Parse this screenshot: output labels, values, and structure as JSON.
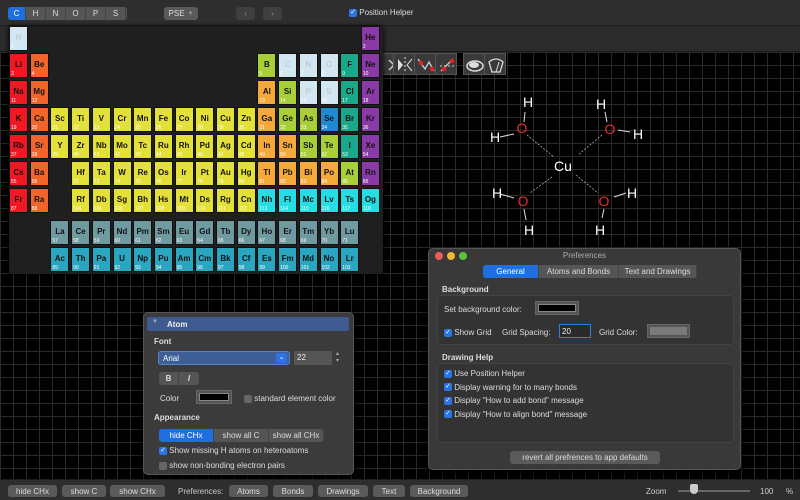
{
  "topbar": {
    "element_buttons": [
      {
        "label": "C",
        "selected": true
      },
      {
        "label": "H",
        "selected": false
      },
      {
        "label": "N",
        "selected": false
      },
      {
        "label": "O",
        "selected": false
      },
      {
        "label": "P",
        "selected": false
      },
      {
        "label": "S",
        "selected": false
      }
    ],
    "pse_label": "PSE",
    "back_icon": "chevron-left",
    "forward_icon": "chevron-right",
    "position_helper_label": "Position Helper",
    "position_helper_checked": true
  },
  "toolbar": {
    "tools": [
      "rotate-tool",
      "mirror-tool",
      "flip-bond-red-tool",
      "flip-bond-red-alt-tool",
      "eraser-tool",
      "wiper-tool"
    ]
  },
  "periodic_table": {
    "elements": [
      {
        "s": "H",
        "n": 1,
        "r": 1,
        "c": 1,
        "cat": "nonmetal-light"
      },
      {
        "s": "He",
        "n": 2,
        "r": 1,
        "c": 18,
        "cat": "noble"
      },
      {
        "s": "Li",
        "n": 3,
        "r": 2,
        "c": 1,
        "cat": "alkali"
      },
      {
        "s": "Be",
        "n": 4,
        "r": 2,
        "c": 2,
        "cat": "alkaline"
      },
      {
        "s": "B",
        "n": 5,
        "r": 2,
        "c": 13,
        "cat": "metalloid"
      },
      {
        "s": "C",
        "n": 6,
        "r": 2,
        "c": 14,
        "cat": "nonmetal-light"
      },
      {
        "s": "N",
        "n": 7,
        "r": 2,
        "c": 15,
        "cat": "nonmetal-light"
      },
      {
        "s": "O",
        "n": 8,
        "r": 2,
        "c": 16,
        "cat": "nonmetal-light"
      },
      {
        "s": "F",
        "n": 9,
        "r": 2,
        "c": 17,
        "cat": "halogen"
      },
      {
        "s": "Ne",
        "n": 10,
        "r": 2,
        "c": 18,
        "cat": "noble"
      },
      {
        "s": "Na",
        "n": 11,
        "r": 3,
        "c": 1,
        "cat": "alkali"
      },
      {
        "s": "Mg",
        "n": 12,
        "r": 3,
        "c": 2,
        "cat": "alkaline"
      },
      {
        "s": "Al",
        "n": 13,
        "r": 3,
        "c": 13,
        "cat": "post"
      },
      {
        "s": "Si",
        "n": 14,
        "r": 3,
        "c": 14,
        "cat": "metalloid"
      },
      {
        "s": "P",
        "n": 15,
        "r": 3,
        "c": 15,
        "cat": "nonmetal-light"
      },
      {
        "s": "S",
        "n": 16,
        "r": 3,
        "c": 16,
        "cat": "nonmetal-light"
      },
      {
        "s": "Cl",
        "n": 17,
        "r": 3,
        "c": 17,
        "cat": "halogen"
      },
      {
        "s": "Ar",
        "n": 18,
        "r": 3,
        "c": 18,
        "cat": "noble"
      },
      {
        "s": "K",
        "n": 19,
        "r": 4,
        "c": 1,
        "cat": "alkali"
      },
      {
        "s": "Ca",
        "n": 20,
        "r": 4,
        "c": 2,
        "cat": "alkaline"
      },
      {
        "s": "Sc",
        "n": 21,
        "r": 4,
        "c": 3,
        "cat": "transition"
      },
      {
        "s": "Ti",
        "n": 22,
        "r": 4,
        "c": 4,
        "cat": "transition"
      },
      {
        "s": "V",
        "n": 23,
        "r": 4,
        "c": 5,
        "cat": "transition"
      },
      {
        "s": "Cr",
        "n": 24,
        "r": 4,
        "c": 6,
        "cat": "transition"
      },
      {
        "s": "Mn",
        "n": 25,
        "r": 4,
        "c": 7,
        "cat": "transition"
      },
      {
        "s": "Fe",
        "n": 26,
        "r": 4,
        "c": 8,
        "cat": "transition"
      },
      {
        "s": "Co",
        "n": 27,
        "r": 4,
        "c": 9,
        "cat": "transition"
      },
      {
        "s": "Ni",
        "n": 28,
        "r": 4,
        "c": 10,
        "cat": "transition"
      },
      {
        "s": "Cu",
        "n": 29,
        "r": 4,
        "c": 11,
        "cat": "transition"
      },
      {
        "s": "Zn",
        "n": 30,
        "r": 4,
        "c": 12,
        "cat": "transition"
      },
      {
        "s": "Ga",
        "n": 31,
        "r": 4,
        "c": 13,
        "cat": "post"
      },
      {
        "s": "Ge",
        "n": 32,
        "r": 4,
        "c": 14,
        "cat": "metalloid"
      },
      {
        "s": "As",
        "n": 33,
        "r": 4,
        "c": 15,
        "cat": "metalloid"
      },
      {
        "s": "Se",
        "n": 34,
        "r": 4,
        "c": 16,
        "cat": "selenium"
      },
      {
        "s": "Br",
        "n": 35,
        "r": 4,
        "c": 17,
        "cat": "halogen"
      },
      {
        "s": "Kr",
        "n": 36,
        "r": 4,
        "c": 18,
        "cat": "noble"
      },
      {
        "s": "Rb",
        "n": 37,
        "r": 5,
        "c": 1,
        "cat": "alkali"
      },
      {
        "s": "Sr",
        "n": 38,
        "r": 5,
        "c": 2,
        "cat": "alkaline"
      },
      {
        "s": "Y",
        "n": 39,
        "r": 5,
        "c": 3,
        "cat": "transition"
      },
      {
        "s": "Zr",
        "n": 40,
        "r": 5,
        "c": 4,
        "cat": "transition"
      },
      {
        "s": "Nb",
        "n": 41,
        "r": 5,
        "c": 5,
        "cat": "transition"
      },
      {
        "s": "Mo",
        "n": 42,
        "r": 5,
        "c": 6,
        "cat": "transition"
      },
      {
        "s": "Tc",
        "n": 43,
        "r": 5,
        "c": 7,
        "cat": "transition"
      },
      {
        "s": "Ru",
        "n": 44,
        "r": 5,
        "c": 8,
        "cat": "transition"
      },
      {
        "s": "Rh",
        "n": 45,
        "r": 5,
        "c": 9,
        "cat": "transition"
      },
      {
        "s": "Pd",
        "n": 46,
        "r": 5,
        "c": 10,
        "cat": "transition"
      },
      {
        "s": "Ag",
        "n": 47,
        "r": 5,
        "c": 11,
        "cat": "transition"
      },
      {
        "s": "Cd",
        "n": 48,
        "r": 5,
        "c": 12,
        "cat": "transition"
      },
      {
        "s": "In",
        "n": 49,
        "r": 5,
        "c": 13,
        "cat": "post"
      },
      {
        "s": "Sn",
        "n": 50,
        "r": 5,
        "c": 14,
        "cat": "post"
      },
      {
        "s": "Sb",
        "n": 51,
        "r": 5,
        "c": 15,
        "cat": "metalloid"
      },
      {
        "s": "Te",
        "n": 52,
        "r": 5,
        "c": 16,
        "cat": "metalloid"
      },
      {
        "s": "I",
        "n": 53,
        "r": 5,
        "c": 17,
        "cat": "halogen"
      },
      {
        "s": "Xe",
        "n": 54,
        "r": 5,
        "c": 18,
        "cat": "noble"
      },
      {
        "s": "Cs",
        "n": 55,
        "r": 6,
        "c": 1,
        "cat": "alkali"
      },
      {
        "s": "Ba",
        "n": 56,
        "r": 6,
        "c": 2,
        "cat": "alkaline"
      },
      {
        "s": "Hf",
        "n": 72,
        "r": 6,
        "c": 4,
        "cat": "transition"
      },
      {
        "s": "Ta",
        "n": 73,
        "r": 6,
        "c": 5,
        "cat": "transition"
      },
      {
        "s": "W",
        "n": 74,
        "r": 6,
        "c": 6,
        "cat": "transition"
      },
      {
        "s": "Re",
        "n": 75,
        "r": 6,
        "c": 7,
        "cat": "transition"
      },
      {
        "s": "Os",
        "n": 76,
        "r": 6,
        "c": 8,
        "cat": "transition"
      },
      {
        "s": "Ir",
        "n": 77,
        "r": 6,
        "c": 9,
        "cat": "transition"
      },
      {
        "s": "Pt",
        "n": 78,
        "r": 6,
        "c": 10,
        "cat": "transition"
      },
      {
        "s": "Au",
        "n": 79,
        "r": 6,
        "c": 11,
        "cat": "transition"
      },
      {
        "s": "Hg",
        "n": 80,
        "r": 6,
        "c": 12,
        "cat": "transition"
      },
      {
        "s": "Tl",
        "n": 81,
        "r": 6,
        "c": 13,
        "cat": "post"
      },
      {
        "s": "Pb",
        "n": 82,
        "r": 6,
        "c": 14,
        "cat": "post"
      },
      {
        "s": "Bi",
        "n": 83,
        "r": 6,
        "c": 15,
        "cat": "post"
      },
      {
        "s": "Po",
        "n": 84,
        "r": 6,
        "c": 16,
        "cat": "post"
      },
      {
        "s": "At",
        "n": 85,
        "r": 6,
        "c": 17,
        "cat": "metalloid"
      },
      {
        "s": "Rn",
        "n": 86,
        "r": 6,
        "c": 18,
        "cat": "noble"
      },
      {
        "s": "Fr",
        "n": 87,
        "r": 7,
        "c": 1,
        "cat": "alkali"
      },
      {
        "s": "Ra",
        "n": 88,
        "r": 7,
        "c": 2,
        "cat": "alkaline"
      },
      {
        "s": "Rf",
        "n": 104,
        "r": 7,
        "c": 4,
        "cat": "transition"
      },
      {
        "s": "Db",
        "n": 105,
        "r": 7,
        "c": 5,
        "cat": "transition"
      },
      {
        "s": "Sg",
        "n": 106,
        "r": 7,
        "c": 6,
        "cat": "transition"
      },
      {
        "s": "Bh",
        "n": 107,
        "r": 7,
        "c": 7,
        "cat": "transition"
      },
      {
        "s": "Hs",
        "n": 108,
        "r": 7,
        "c": 8,
        "cat": "transition"
      },
      {
        "s": "Mt",
        "n": 109,
        "r": 7,
        "c": 9,
        "cat": "transition"
      },
      {
        "s": "Ds",
        "n": 110,
        "r": 7,
        "c": 10,
        "cat": "transition"
      },
      {
        "s": "Rg",
        "n": 111,
        "r": 7,
        "c": 11,
        "cat": "transition"
      },
      {
        "s": "Cn",
        "n": 112,
        "r": 7,
        "c": 12,
        "cat": "transition"
      },
      {
        "s": "Nh",
        "n": 113,
        "r": 7,
        "c": 13,
        "cat": "unknown"
      },
      {
        "s": "Fl",
        "n": 114,
        "r": 7,
        "c": 14,
        "cat": "unknown"
      },
      {
        "s": "Mc",
        "n": 115,
        "r": 7,
        "c": 15,
        "cat": "unknown"
      },
      {
        "s": "Lv",
        "n": 116,
        "r": 7,
        "c": 16,
        "cat": "unknown"
      },
      {
        "s": "Ts",
        "n": 117,
        "r": 7,
        "c": 17,
        "cat": "unknown"
      },
      {
        "s": "Og",
        "n": 118,
        "r": 7,
        "c": 18,
        "cat": "unknown"
      },
      {
        "s": "La",
        "n": 57,
        "r": 8,
        "c": 3,
        "cat": "lanthanide"
      },
      {
        "s": "Ce",
        "n": 58,
        "r": 8,
        "c": 4,
        "cat": "lanthanide"
      },
      {
        "s": "Pr",
        "n": 59,
        "r": 8,
        "c": 5,
        "cat": "lanthanide"
      },
      {
        "s": "Nd",
        "n": 60,
        "r": 8,
        "c": 6,
        "cat": "lanthanide"
      },
      {
        "s": "Pm",
        "n": 61,
        "r": 8,
        "c": 7,
        "cat": "lanthanide"
      },
      {
        "s": "Sm",
        "n": 62,
        "r": 8,
        "c": 8,
        "cat": "lanthanide"
      },
      {
        "s": "Eu",
        "n": 63,
        "r": 8,
        "c": 9,
        "cat": "lanthanide"
      },
      {
        "s": "Gd",
        "n": 64,
        "r": 8,
        "c": 10,
        "cat": "lanthanide"
      },
      {
        "s": "Tb",
        "n": 65,
        "r": 8,
        "c": 11,
        "cat": "lanthanide"
      },
      {
        "s": "Dy",
        "n": 66,
        "r": 8,
        "c": 12,
        "cat": "lanthanide"
      },
      {
        "s": "Ho",
        "n": 67,
        "r": 8,
        "c": 13,
        "cat": "lanthanide"
      },
      {
        "s": "Er",
        "n": 68,
        "r": 8,
        "c": 14,
        "cat": "lanthanide"
      },
      {
        "s": "Tm",
        "n": 69,
        "r": 8,
        "c": 15,
        "cat": "lanthanide"
      },
      {
        "s": "Yb",
        "n": 70,
        "r": 8,
        "c": 16,
        "cat": "lanthanide"
      },
      {
        "s": "Lu",
        "n": 71,
        "r": 8,
        "c": 17,
        "cat": "lanthanide"
      },
      {
        "s": "Ac",
        "n": 89,
        "r": 9,
        "c": 3,
        "cat": "actinide"
      },
      {
        "s": "Th",
        "n": 90,
        "r": 9,
        "c": 4,
        "cat": "actinide"
      },
      {
        "s": "Pa",
        "n": 91,
        "r": 9,
        "c": 5,
        "cat": "actinide"
      },
      {
        "s": "U",
        "n": 92,
        "r": 9,
        "c": 6,
        "cat": "actinide"
      },
      {
        "s": "Np",
        "n": 93,
        "r": 9,
        "c": 7,
        "cat": "actinide"
      },
      {
        "s": "Pu",
        "n": 94,
        "r": 9,
        "c": 8,
        "cat": "actinide"
      },
      {
        "s": "Am",
        "n": 95,
        "r": 9,
        "c": 9,
        "cat": "actinide"
      },
      {
        "s": "Cm",
        "n": 96,
        "r": 9,
        "c": 10,
        "cat": "actinide"
      },
      {
        "s": "Bk",
        "n": 97,
        "r": 9,
        "c": 11,
        "cat": "actinide"
      },
      {
        "s": "Cf",
        "n": 98,
        "r": 9,
        "c": 12,
        "cat": "actinide"
      },
      {
        "s": "Es",
        "n": 99,
        "r": 9,
        "c": 13,
        "cat": "actinide"
      },
      {
        "s": "Fm",
        "n": 100,
        "r": 9,
        "c": 14,
        "cat": "actinide"
      },
      {
        "s": "Md",
        "n": 101,
        "r": 9,
        "c": 15,
        "cat": "actinide"
      },
      {
        "s": "No",
        "n": 102,
        "r": 9,
        "c": 16,
        "cat": "actinide"
      },
      {
        "s": "Lr",
        "n": 103,
        "r": 9,
        "c": 17,
        "cat": "actinide"
      }
    ],
    "category_colors": {
      "alkali": "#f01822",
      "alkaline": "#f2652a",
      "transition": "#e4e03a",
      "post": "#f5a93a",
      "metalloid": "#a9cf38",
      "nonmetal-light": "#d3e7f3",
      "halogen": "#1aa88a",
      "noble": "#8a3aa6",
      "selenium": "#1a8ccf",
      "unknown": "#25dde3",
      "lanthanide": "#6f9aa0",
      "actinide": "#2aa6c0"
    }
  },
  "molecule": {
    "center": "Cu",
    "ligand_atom": "O",
    "hydrogen": "H",
    "atom_color_O": "#e0302a"
  },
  "preferences": {
    "title": "Preferences",
    "tabs": [
      {
        "label": "General",
        "selected": true
      },
      {
        "label": "Atoms and Bonds",
        "selected": false
      },
      {
        "label": "Text and Drawings",
        "selected": false
      }
    ],
    "background": {
      "heading": "Background",
      "bg_color_label": "Set background color:",
      "bg_color": "#000000",
      "show_grid_label": "Show Grid",
      "show_grid_checked": true,
      "grid_spacing_label": "Grid Spacing:",
      "grid_spacing_value": "20",
      "grid_color_label": "Grid Color:",
      "grid_color": "#7a7a7a"
    },
    "drawing_help": {
      "heading": "Drawing Help",
      "options": [
        {
          "label": "Use Position Helper",
          "checked": true
        },
        {
          "label": "Display warning for to many bonds",
          "checked": true
        },
        {
          "label": "Display \"How to add bond\" message",
          "checked": true
        },
        {
          "label": "Display \"How to align bond\" message",
          "checked": true
        }
      ]
    },
    "revert_label": "revert all prefrences to app defaults"
  },
  "atom_panel": {
    "title": "Atom",
    "font_heading": "Font",
    "font_name": "Arial",
    "font_size": "22",
    "bold_label": "B",
    "italic_label": "I",
    "color_label": "Color",
    "color": "#000000",
    "standard_color_label": "standard element color",
    "standard_color_checked": false,
    "appearance_heading": "Appearance",
    "appearance_options": [
      {
        "label": "hide CHx",
        "selected": true
      },
      {
        "label": "show all C",
        "selected": false
      },
      {
        "label": "show all CHx",
        "selected": false
      }
    ],
    "show_missing_h_label": "Show missing H atoms on heteroatoms",
    "show_missing_h_checked": true,
    "show_pairs_label": "show non-bonding electron pairs",
    "show_pairs_checked": false
  },
  "bottombar": {
    "hide_chx": "hide CHx",
    "show_c": "show C",
    "show_chx": "show CHx",
    "preferences_label": "Preferences:",
    "pref_buttons": [
      "Atoms",
      "Bonds",
      "Drawings",
      "Text",
      "Background"
    ],
    "zoom_label": "Zoom",
    "zoom_value": "100",
    "zoom_unit": "%",
    "zoom_slider_fraction": 0.22
  }
}
